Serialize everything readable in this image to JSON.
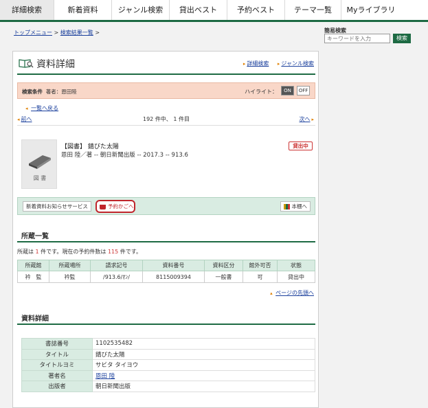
{
  "nav": {
    "tabs": [
      "詳細検索",
      "新着資料",
      "ジャンル検索",
      "貸出ベスト",
      "予約ベスト",
      "テーマ一覧",
      "Myライブラリ"
    ]
  },
  "breadcrumb": {
    "top": "トップメニュー",
    "sep": ">",
    "results": "検索結果一覧",
    "sep2": ">"
  },
  "quick_search": {
    "label": "簡易検索",
    "placeholder": "キーワードを入力",
    "button": "検索"
  },
  "page": {
    "title": "資料詳細",
    "link_detail": "詳細検索",
    "link_genre": "ジャンル検索"
  },
  "condition": {
    "label": "検索条件",
    "value": "著者：恩田陸",
    "highlight": "ハイライト：",
    "on": "ON",
    "off": "OFF"
  },
  "back_link": "一覧へ戻る",
  "pager": {
    "prev": "前へ",
    "count": "192 件中、 1 件目",
    "next": "次へ"
  },
  "item": {
    "kind": "図 書",
    "title": "【図書】 錆びた太陽",
    "sub": "恩田 陸／著 -- 朝日新聞出版 -- 2017.3 -- 913.6",
    "status": "貸出中"
  },
  "service": {
    "notify": "新着資料お知らせサービス",
    "reserve": "予約かごへ",
    "shelf": "本棚へ"
  },
  "holdings": {
    "heading": "所蔵一覧",
    "info_a": "所蔵は ",
    "count": "1",
    "info_b": " 件です。現在の予約件数は ",
    "reserves": "115",
    "info_c": " 件です。",
    "columns": [
      "所蔵館",
      "所蔵場所",
      "請求記号",
      "資料番号",
      "資料区分",
      "館外可否",
      "状態"
    ],
    "rows": [
      [
        "衿　監",
        "衿監",
        "/913.6/ｵﾝ/",
        "8115009394",
        "一般書",
        "可",
        "貸出中"
      ]
    ]
  },
  "to_top": "ページの先頭へ",
  "detail": {
    "heading": "資料詳細",
    "rows": [
      [
        "書誌番号",
        "1102535482"
      ],
      [
        "タイトル",
        "錆びた太陽"
      ],
      [
        "タイトルヨミ",
        "サビタ タイヨウ"
      ],
      [
        "著者名",
        "恩田 陸"
      ],
      [
        "出版者",
        "朝日新聞出版"
      ]
    ]
  },
  "colors": {
    "accent": "#1d6a43",
    "condition_bg": "#f9d7c8",
    "reserve_red": "#c0242b"
  }
}
